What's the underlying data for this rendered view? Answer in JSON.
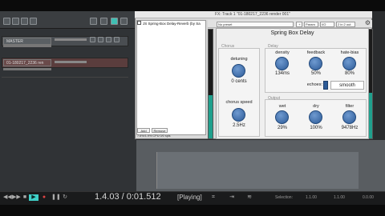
{
  "fx_window": {
    "title": "FX: Track 1 \"01-180217_2236 render 001\"",
    "fx_item": "JS Spring-Box Delay-Reverb (by Sa",
    "preset": "No preset",
    "preset_plus": "+",
    "param_label": "Param",
    "io_label": "I/O",
    "io_value": "2 in 2 out",
    "add_label": "Add",
    "remove_label": "Remove",
    "cpu_text": "7.6%/1.9% CPU 0/0 spls"
  },
  "plugin": {
    "name": "Spring Box Delay",
    "sections": {
      "chorus": "Chorus",
      "delay": "Delay",
      "output": "Output"
    },
    "detuning": {
      "label": "detuning",
      "value": "0 cents"
    },
    "chorus_speed": {
      "label": "chorus speed",
      "value": "2.5Hz"
    },
    "density": {
      "label": "density",
      "value": "134ms"
    },
    "feedback": {
      "label": "feedback",
      "value": "50%"
    },
    "hi_bias": {
      "label": "hate-bias",
      "value": "80%"
    },
    "echoes": {
      "label": "echoes:",
      "value": "smooth"
    },
    "wet": {
      "label": "wet",
      "value": "29%"
    },
    "dry": {
      "label": "dry",
      "value": "100%"
    },
    "filter": {
      "label": "filter",
      "value": "9478Hz"
    }
  },
  "tracks": [
    {
      "name": "MASTER"
    },
    {
      "name": "01-180217_2236 ren"
    }
  ],
  "transport": {
    "timecode": "1.4.03 / 0:01.512",
    "state": "[Playing]",
    "selection_label": "Selection:",
    "sel_start": "1.1.00",
    "sel_end": "1.1.00",
    "sel_len": "0.0.00"
  },
  "colors": {
    "accent": "#2d5b98",
    "meter": "#1fa08d",
    "record": "#3fd0c8"
  },
  "icons": [
    "gear-icon",
    "play-icon",
    "stop-icon",
    "record-icon",
    "rewind-icon",
    "forward-icon",
    "loop-icon"
  ]
}
